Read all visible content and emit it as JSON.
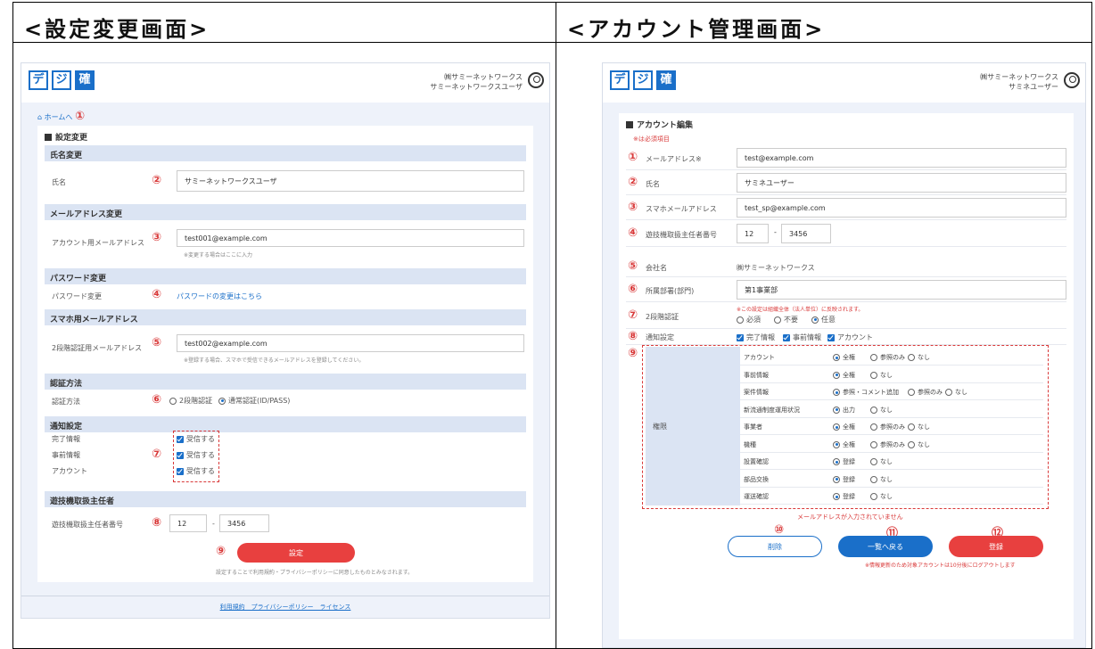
{
  "left": {
    "title": "<設定変更画面>",
    "company": "㈱サミーネットワークス",
    "user": "サミーネットワークスユーザ",
    "breadcrumb": "ホームへ",
    "card_title": "設定変更",
    "sections": {
      "name_head": "氏名変更",
      "name_label": "氏名",
      "name_value": "サミーネットワークスユーザ",
      "mail_head": "メールアドレス変更",
      "mail_label": "アカウント用メールアドレス",
      "mail_value": "test001@example.com",
      "mail_note": "※変更する場合はここに入力",
      "pw_head": "パスワード変更",
      "pw_label": "パスワード変更",
      "pw_link": "パスワードの変更はこちら",
      "sp_head": "スマホ用メールアドレス",
      "sp_label": "2段階認証用メールアドレス",
      "sp_value": "test002@example.com",
      "sp_note": "※登録する場合、スマホで受信できるメールアドレスを登録してください。",
      "auth_head": "認証方法",
      "auth_label": "認証方法",
      "auth_opt1": "2段階認証",
      "auth_opt2": "通常認証(ID/PASS)",
      "notify_head": "通知設定",
      "notify_rows": [
        "完了情報",
        "事前情報",
        "アカウント"
      ],
      "notify_value": "受信する",
      "staff_head": "遊技機取扱主任者",
      "staff_label": "遊技機取扱主任者番号",
      "staff_a": "12",
      "staff_b": "3456"
    },
    "submit": "設定",
    "agree": "設定することで利用規約・プライバシーポリシーに同意したものとみなされます。",
    "footer": "利用規約　プライバシーポリシー　ライセンス",
    "nums": [
      "①",
      "②",
      "③",
      "④",
      "⑤",
      "⑥",
      "⑦",
      "⑧",
      "⑨"
    ]
  },
  "right": {
    "title": "<アカウント管理画面>",
    "company": "㈱サミーネットワークス",
    "user": "サミネユーザー",
    "card_title": "アカウント編集",
    "required": "※は必須項目",
    "mail_label": "メールアドレス※",
    "mail_value": "test@example.com",
    "name_label": "氏名",
    "name_value": "サミネユーザー",
    "sp_label": "スマホメールアドレス",
    "sp_value": "test_sp@example.com",
    "staff_label": "遊技機取扱主任者番号",
    "staff_a": "12",
    "staff_b": "3456",
    "company_label": "会社名",
    "company_value": "㈱サミーネットワークス",
    "dept_label": "所属部署(部門)",
    "dept_value": "第1事業部",
    "auth_label": "2段階認証",
    "auth_note": "※この設定は組織全体（法人単位）に反映されます。",
    "auth_opts": [
      "必須",
      "不要",
      "任意"
    ],
    "notify_label": "通知設定",
    "notify_opts": [
      "完了情報",
      "事前情報",
      "アカウント"
    ],
    "perm_label": "権限",
    "perm_rows": [
      {
        "name": "アカウント",
        "opts": [
          "全権",
          "参照のみ",
          "なし"
        ]
      },
      {
        "name": "事前情報",
        "opts": [
          "全権",
          "なし"
        ]
      },
      {
        "name": "案件情報",
        "opts": [
          "参照・コメント追加",
          "参照のみ",
          "なし"
        ]
      },
      {
        "name": "新流通制度運用状況",
        "opts": [
          "出力",
          "なし"
        ]
      },
      {
        "name": "事業者",
        "opts": [
          "全権",
          "参照のみ",
          "なし"
        ]
      },
      {
        "name": "機種",
        "opts": [
          "全権",
          "参照のみ",
          "なし"
        ]
      },
      {
        "name": "設置確認",
        "opts": [
          "登録",
          "なし"
        ]
      },
      {
        "name": "部品交換",
        "opts": [
          "登録",
          "なし"
        ]
      },
      {
        "name": "運送確認",
        "opts": [
          "登録",
          "なし"
        ]
      }
    ],
    "error": "メールアドレスが入力されていません",
    "delete": "削除",
    "back": "一覧へ戻る",
    "register": "登録",
    "logout_note": "※情報更新のため対象アカウントは10分後にログアウトします",
    "nums": [
      "①",
      "②",
      "③",
      "④",
      "⑤",
      "⑥",
      "⑦",
      "⑧",
      "⑨",
      "⑩",
      "⑪",
      "⑫"
    ]
  }
}
